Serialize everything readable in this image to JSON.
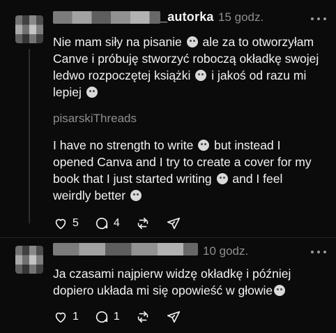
{
  "posts": [
    {
      "username": "_autorka",
      "time": "15 godz.",
      "text_lines": [
        "Nie mam siły na pisanie",
        "ale za to otworzyłam",
        "Canve i próbuję stworzyć roboczą okładkę swojej",
        "ledwo rozpoczętej książki",
        "i jakoś od razu mi",
        "lepiej"
      ],
      "translation_label": "pisarskiThreads",
      "translation_lines": [
        "I have no strength to write",
        "but instead I",
        "opened Canva and I try to create a cover for my",
        "book that I just started writing",
        "and I feel",
        "weirdly better"
      ],
      "likes": "5",
      "replies": "4"
    },
    {
      "username": "",
      "time": "10 godz.",
      "text_lines": [
        "Ja czasami najpierw widzę okładkę i później",
        "dopiero układa mi się opowieść w głowie"
      ],
      "likes": "1",
      "replies": "1"
    }
  ],
  "icons": {
    "like": "heart-icon",
    "reply": "comment-icon",
    "repost": "repost-icon",
    "share": "send-icon",
    "more": "more-icon"
  },
  "colors": {
    "background": "#0b0b0b",
    "text": "#f3f3f3",
    "muted": "#8e8e8e"
  }
}
